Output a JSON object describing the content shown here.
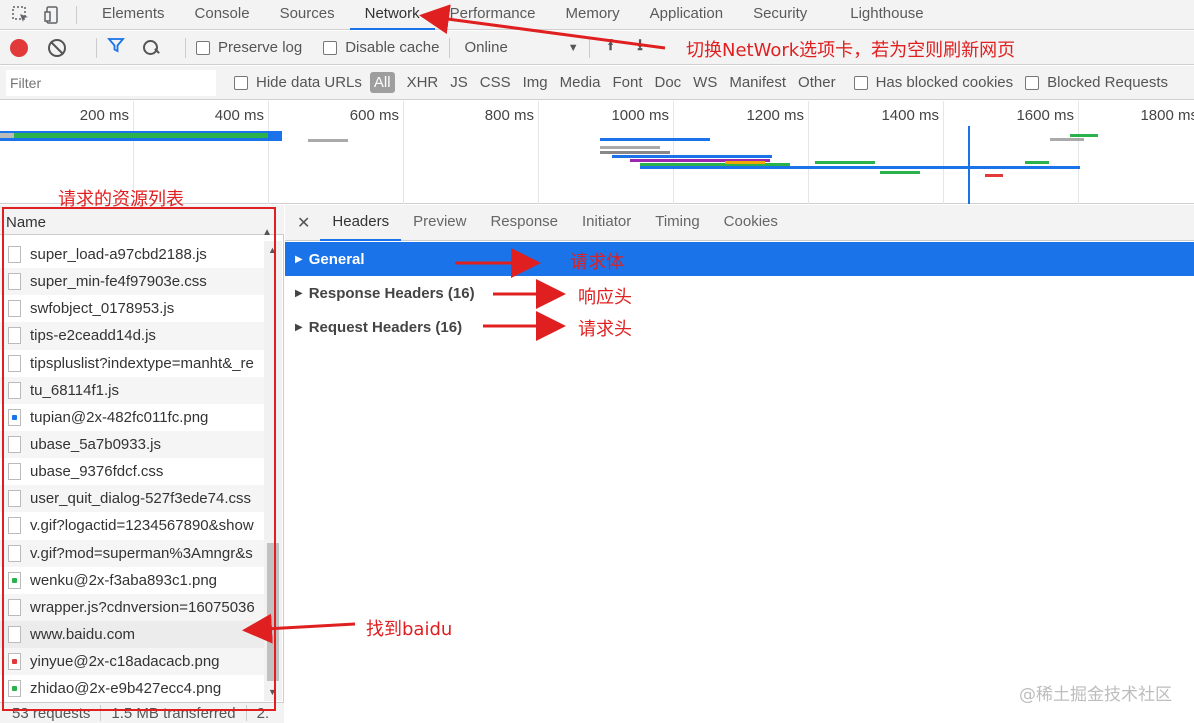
{
  "tabbar": {
    "tabs": [
      "Elements",
      "Console",
      "Sources",
      "Network",
      "Performance",
      "Memory",
      "Application",
      "Security",
      "Lighthouse"
    ],
    "active": "Network"
  },
  "toolbar": {
    "preserve_log": "Preserve log",
    "disable_cache": "Disable cache",
    "throttle": "Online"
  },
  "filterbar": {
    "placeholder": "Filter",
    "hide_data_urls": "Hide data URLs",
    "types": [
      "All",
      "XHR",
      "JS",
      "CSS",
      "Img",
      "Media",
      "Font",
      "Doc",
      "WS",
      "Manifest",
      "Other"
    ],
    "has_blocked_cookies": "Has blocked cookies",
    "blocked_requests": "Blocked Requests"
  },
  "overview": {
    "ticks": [
      "200 ms",
      "400 ms",
      "600 ms",
      "800 ms",
      "1000 ms",
      "1200 ms",
      "1400 ms",
      "1600 ms",
      "1800 ms"
    ]
  },
  "requests": {
    "column": "Name",
    "rows": [
      {
        "name": "super_load-a97cbd2188.js",
        "icon": "file"
      },
      {
        "name": "super_min-fe4f97903e.css",
        "icon": "file"
      },
      {
        "name": "swfobject_0178953.js",
        "icon": "file"
      },
      {
        "name": "tips-e2ceadd14d.js",
        "icon": "file"
      },
      {
        "name": "tipspluslist?indextype=manht&_re",
        "icon": "file"
      },
      {
        "name": "tu_68114f1.js",
        "icon": "file"
      },
      {
        "name": "tupian@2x-482fc011fc.png",
        "icon": "image-blue"
      },
      {
        "name": "ubase_5a7b0933.js",
        "icon": "file"
      },
      {
        "name": "ubase_9376fdcf.css",
        "icon": "file"
      },
      {
        "name": "user_quit_dialog-527f3ede74.css",
        "icon": "file"
      },
      {
        "name": "v.gif?logactid=1234567890&show",
        "icon": "file"
      },
      {
        "name": "v.gif?mod=superman%3Amngr&s",
        "icon": "file"
      },
      {
        "name": "wenku@2x-f3aba893c1.png",
        "icon": "image-green"
      },
      {
        "name": "wrapper.js?cdnversion=16075036",
        "icon": "file"
      },
      {
        "name": "www.baidu.com",
        "icon": "file",
        "selected": true
      },
      {
        "name": "yinyue@2x-c18adacacb.png",
        "icon": "image-red"
      },
      {
        "name": "zhidao@2x-e9b427ecc4.png",
        "icon": "image-green"
      }
    ],
    "status": {
      "count": "53 requests",
      "transferred": "1.5 MB transferred",
      "extra": "2."
    }
  },
  "details": {
    "tabs": [
      "Headers",
      "Preview",
      "Response",
      "Initiator",
      "Timing",
      "Cookies"
    ],
    "active": "Headers",
    "sections": [
      {
        "label": "General",
        "expanded": false
      },
      {
        "label": "Response Headers (16)"
      },
      {
        "label": "Request Headers (16)"
      }
    ]
  },
  "annotations": {
    "switch_tab": "切换NetWork选项卡，若为空则刷新网页",
    "resource_list": "请求的资源列表",
    "request_body": "请求体",
    "response_header": "响应头",
    "request_header": "请求头",
    "find_baidu": "找到baidu"
  },
  "colors": {
    "accent": "#1a73e8",
    "annotation": "#e02020",
    "record": "#e23a3a"
  },
  "watermark": "@稀土掘金技术社区"
}
